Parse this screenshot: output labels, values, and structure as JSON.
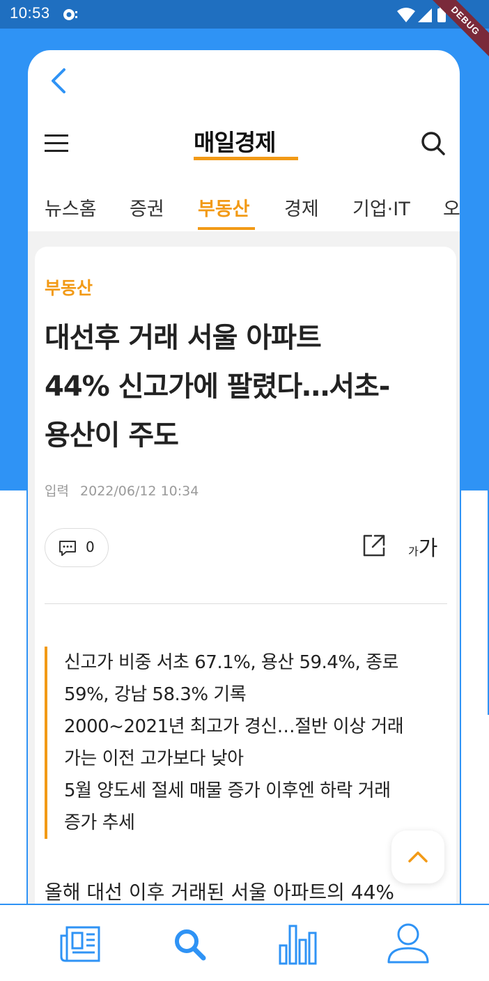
{
  "status_bar": {
    "time": "10:53",
    "debug_label": "DEBUG"
  },
  "colors": {
    "primary_blue": "#2f93f5",
    "accent_orange": "#f29a16",
    "status_bar": "#1f6fc0"
  },
  "masthead": {
    "logo_text": "매일경제",
    "menu_icon": "hamburger-menu-icon",
    "search_icon": "search-icon"
  },
  "tabs": [
    {
      "label": "뉴스홈",
      "active": false
    },
    {
      "label": "증권",
      "active": false
    },
    {
      "label": "부동산",
      "active": true
    },
    {
      "label": "경제",
      "active": false
    },
    {
      "label": "기업·IT",
      "active": false
    },
    {
      "label": "오",
      "active": false
    }
  ],
  "article": {
    "category": "부동산",
    "headline_lines": [
      "대선후 거래 서울 아파트",
      "44% 신고가에 팔렸다…서초-",
      "용산이 주도"
    ],
    "meta_label": "입력",
    "meta_datetime": "2022/06/12 10:34",
    "comment_count": "0",
    "font_small": "가",
    "font_big": "가",
    "summary_lines": [
      "신고가 비중 서초 67.1%, 용산 59.4%, 종로",
      "59%, 강남 58.3% 기록",
      "2000~2021년 최고가 경신…절반 이상 거래",
      "가는 이전 고가보다 낮아",
      "5월 양도세 절세 매물 증가 이후엔 하락 거래",
      "증가 추세"
    ],
    "body_first_line": "올해 대선 이후 거래된 서울 아파트의 44%"
  },
  "bottom_nav": [
    {
      "name": "news",
      "icon": "newspaper-icon"
    },
    {
      "name": "search",
      "icon": "search-icon"
    },
    {
      "name": "stats",
      "icon": "bar-chart-icon"
    },
    {
      "name": "profile",
      "icon": "user-icon"
    }
  ]
}
